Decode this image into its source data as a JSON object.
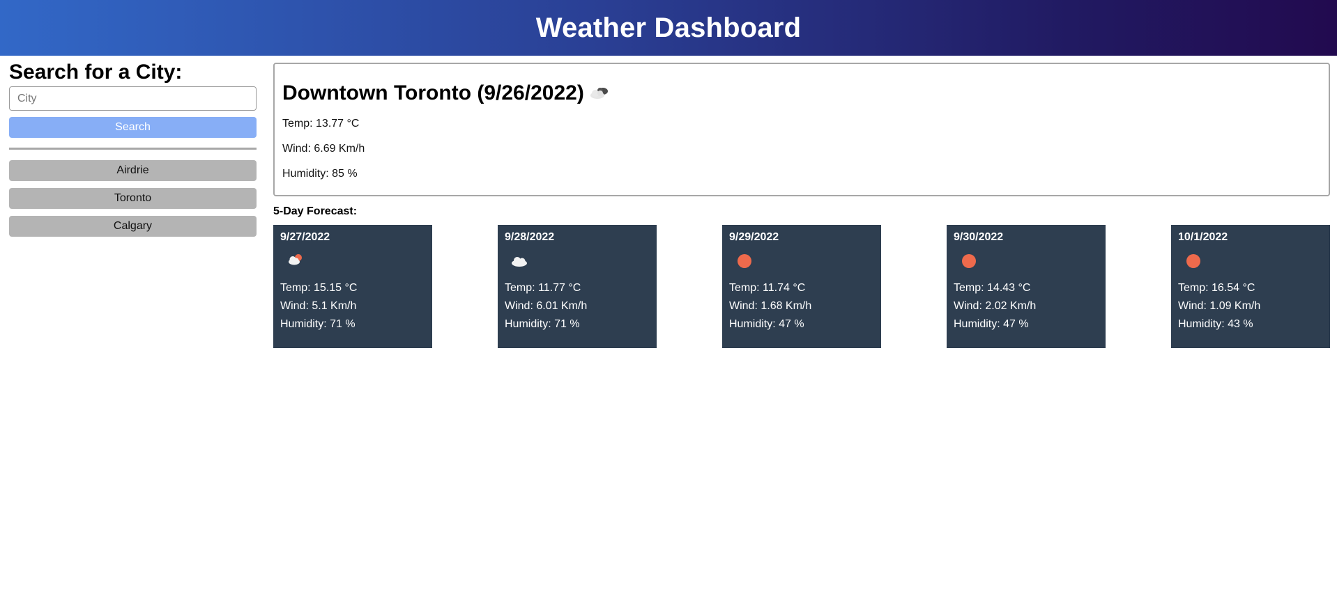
{
  "header": {
    "title": "Weather Dashboard"
  },
  "sidebar": {
    "heading": "Search for a City:",
    "input_placeholder": "City",
    "input_value": "",
    "search_label": "Search",
    "history": [
      "Airdrie",
      "Toronto",
      "Calgary"
    ]
  },
  "current": {
    "title": "Downtown Toronto (9/26/2022)",
    "icon": "overcast-clouds-icon",
    "temp": "Temp: 13.77 °C",
    "wind": "Wind: 6.69 Km/h",
    "humidity": "Humidity: 85 %"
  },
  "forecast": {
    "label": "5-Day Forecast:",
    "days": [
      {
        "date": "9/27/2022",
        "icon": "partly-cloudy-icon",
        "temp": "Temp: 15.15 °C",
        "wind": "Wind: 5.1 Km/h",
        "humidity": "Humidity: 71 %"
      },
      {
        "date": "9/28/2022",
        "icon": "cloud-icon",
        "temp": "Temp: 11.77 °C",
        "wind": "Wind: 6.01 Km/h",
        "humidity": "Humidity: 71 %"
      },
      {
        "date": "9/29/2022",
        "icon": "sun-icon",
        "temp": "Temp: 11.74 °C",
        "wind": "Wind: 1.68 Km/h",
        "humidity": "Humidity: 47 %"
      },
      {
        "date": "9/30/2022",
        "icon": "sun-icon",
        "temp": "Temp: 14.43 °C",
        "wind": "Wind: 2.02 Km/h",
        "humidity": "Humidity: 47 %"
      },
      {
        "date": "10/1/2022",
        "icon": "sun-icon",
        "temp": "Temp: 16.54 °C",
        "wind": "Wind: 1.09 Km/h",
        "humidity": "Humidity: 43 %"
      }
    ]
  },
  "colors": {
    "card_bg": "#2e3e50",
    "search_button": "#87aef6",
    "history_button": "#b4b4b4",
    "sun": "#ee6a4c"
  }
}
